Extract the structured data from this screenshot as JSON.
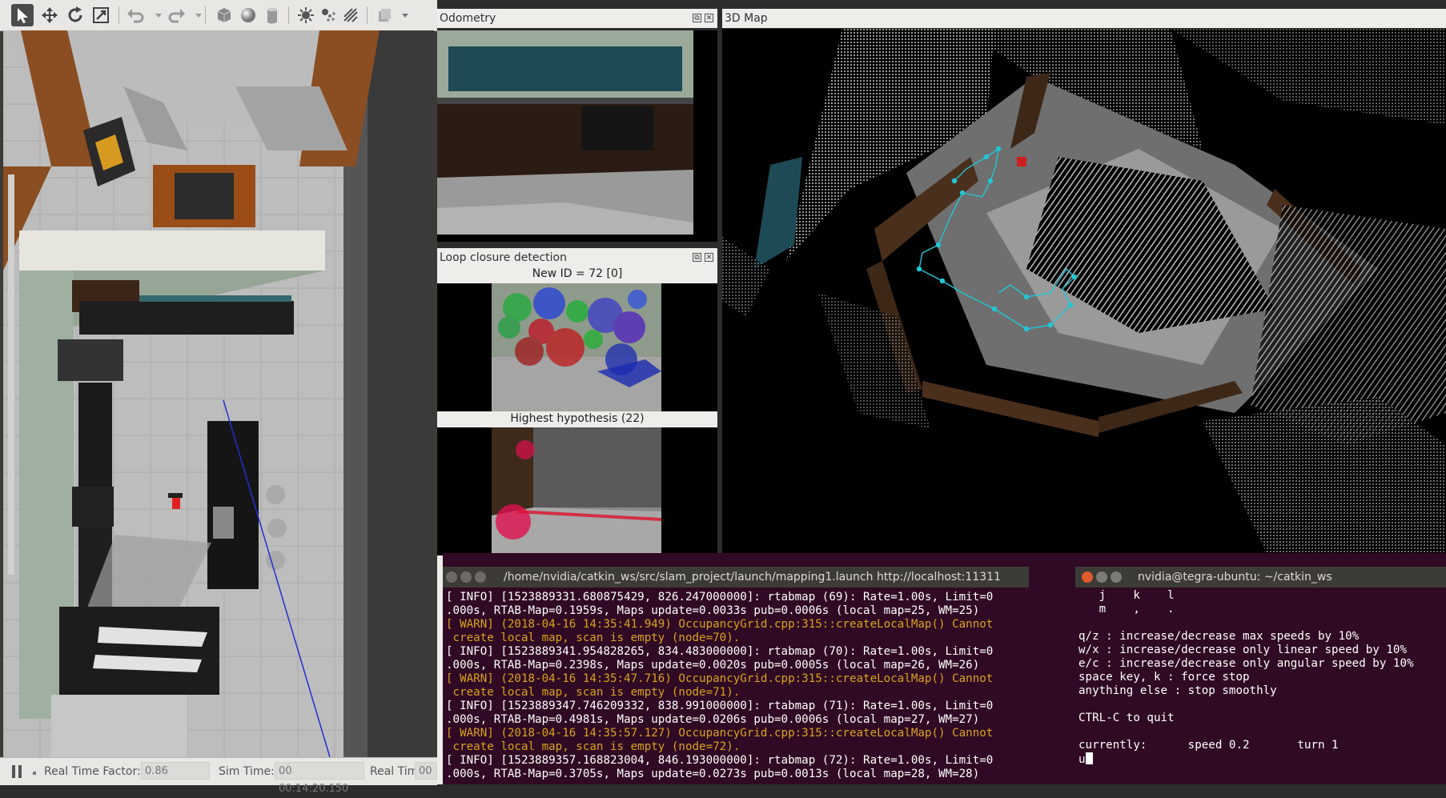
{
  "gazebo": {
    "toolbar_icons": [
      "select-arrow-icon",
      "translate-icon",
      "rotate-icon",
      "scale-icon",
      "undo-icon",
      "undo-dropdown-icon",
      "redo-icon",
      "redo-dropdown-icon",
      "box-shape-icon",
      "sphere-shape-icon",
      "cylinder-shape-icon",
      "point-light-icon",
      "spot-light-icon",
      "directional-light-icon",
      "copy-icon",
      "more-dropdown-icon"
    ],
    "bottom": {
      "real_time_factor_label": "Real Time Factor:",
      "real_time_factor_value": "0.86",
      "sim_time_label": "Sim Time:",
      "sim_time_value": "00 00:14:20.150",
      "real_time_label": "Real Time:",
      "real_time_value": "00"
    }
  },
  "rviz": {
    "odometry": {
      "title": "Odometry"
    },
    "loop_closure": {
      "title": "Loop closure detection",
      "new_id_label": "New ID = 72 [0]",
      "hypothesis_label": "Highest hypothesis (22)"
    },
    "map3d": {
      "title": "3D Map"
    },
    "panel_button_float": "⧉",
    "panel_button_close": "✕"
  },
  "terminal_roslaunch": {
    "title": "/home/nvidia/catkin_ws/src/slam_project/launch/mapping1.launch http://localhost:11311",
    "lines": [
      {
        "type": "info",
        "text": "[ INFO] [1523889331.680875429, 826.247000000]: rtabmap (69): Rate=1.00s, Limit=0"
      },
      {
        "type": "info",
        "text": ".000s, RTAB-Map=0.1959s, Maps update=0.0033s pub=0.0006s (local map=25, WM=25)"
      },
      {
        "type": "warn",
        "text": "[ WARN] (2018-04-16 14:35:41.949) OccupancyGrid.cpp:315::createLocalMap() Cannot"
      },
      {
        "type": "warn",
        "text": " create local map, scan is empty (node=70)."
      },
      {
        "type": "info",
        "text": "[ INFO] [1523889341.954828265, 834.483000000]: rtabmap (70): Rate=1.00s, Limit=0"
      },
      {
        "type": "info",
        "text": ".000s, RTAB-Map=0.2398s, Maps update=0.0020s pub=0.0005s (local map=26, WM=26)"
      },
      {
        "type": "warn",
        "text": "[ WARN] (2018-04-16 14:35:47.716) OccupancyGrid.cpp:315::createLocalMap() Cannot"
      },
      {
        "type": "warn",
        "text": " create local map, scan is empty (node=71)."
      },
      {
        "type": "info",
        "text": "[ INFO] [1523889347.746209332, 838.991000000]: rtabmap (71): Rate=1.00s, Limit=0"
      },
      {
        "type": "info",
        "text": ".000s, RTAB-Map=0.4981s, Maps update=0.0206s pub=0.0006s (local map=27, WM=27)"
      },
      {
        "type": "warn",
        "text": "[ WARN] (2018-04-16 14:35:57.127) OccupancyGrid.cpp:315::createLocalMap() Cannot"
      },
      {
        "type": "warn",
        "text": " create local map, scan is empty (node=72)."
      },
      {
        "type": "info",
        "text": "[ INFO] [1523889357.168823004, 846.193000000]: rtabmap (72): Rate=1.00s, Limit=0"
      },
      {
        "type": "info",
        "text": ".000s, RTAB-Map=0.3705s, Maps update=0.0273s pub=0.0013s (local map=28, WM=28)"
      }
    ]
  },
  "terminal_teleop": {
    "title": "nvidia@tegra-ubuntu: ~/catkin_ws",
    "lines": [
      "   j    k    l",
      "   m    ,    .",
      "",
      "q/z : increase/decrease max speeds by 10%",
      "w/x : increase/decrease only linear speed by 10%",
      "e/c : increase/decrease only angular speed by 10%",
      "space key, k : force stop",
      "anything else : stop smoothly",
      "",
      "CTRL-C to quit",
      "",
      "currently:      speed 0.2       turn 1"
    ],
    "input": "u"
  }
}
